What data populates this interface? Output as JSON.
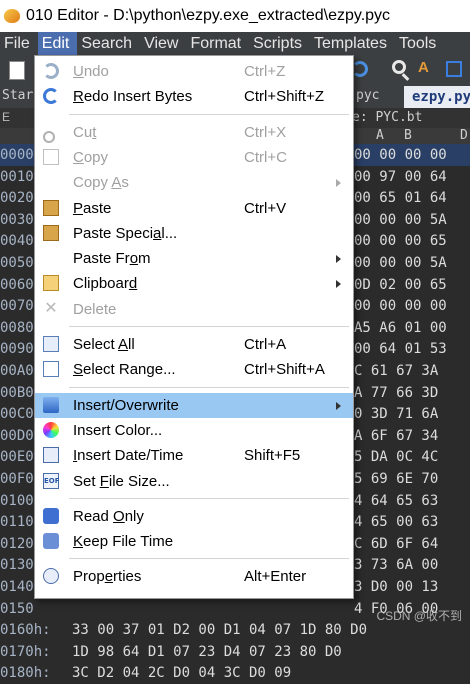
{
  "window": {
    "title": "010 Editor - D:\\python\\ezpy.exe_extracted\\ezpy.pyc"
  },
  "menubar": {
    "items": [
      "File",
      "Edit",
      "Search",
      "View",
      "Format",
      "Scripts",
      "Templates",
      "Tools"
    ],
    "active": "Edit"
  },
  "tabs": {
    "start_label": "Star",
    "pyc_label": "pyc",
    "active_tab": "ezpy.py"
  },
  "template_bar": {
    "label": "e: PYC.bt",
    "left": "E"
  },
  "hex": {
    "header": [
      "A",
      "B",
      "D"
    ],
    "rows": [
      {
        "addr": "0000",
        "cells": "00 00 00 00"
      },
      {
        "addr": "0010",
        "cells": "00 97 00 64"
      },
      {
        "addr": "0020",
        "cells": "00 65 01 64"
      },
      {
        "addr": "0030",
        "cells": "00 00 00 5A"
      },
      {
        "addr": "0040",
        "cells": "00 00 00 65"
      },
      {
        "addr": "0050",
        "cells": "00 00 00 5A"
      },
      {
        "addr": "0060",
        "cells": "0D 02 00 65"
      },
      {
        "addr": "0070",
        "cells": "00 00 00 00"
      },
      {
        "addr": "0080",
        "cells": "A5 A6 01 00"
      },
      {
        "addr": "0090",
        "cells": "00 64 01 53"
      },
      {
        "addr": "00A0",
        "cells": "C 61 67 3A"
      },
      {
        "addr": "00B0",
        "cells": "A 77 66 3D"
      },
      {
        "addr": "00C0",
        "cells": "0 3D 71 6A"
      },
      {
        "addr": "00D0",
        "cells": "A 6F 67 34"
      },
      {
        "addr": "00E0",
        "cells": "5 DA 0C 4C"
      },
      {
        "addr": "00F0",
        "cells": "5 69 6E 70"
      },
      {
        "addr": "0100",
        "cells": "4 64 65 63"
      },
      {
        "addr": "0110",
        "cells": "4 65 00 63"
      },
      {
        "addr": "0120",
        "cells": "C 6D 6F 64"
      },
      {
        "addr": "0130",
        "cells": "3 73 6A 00"
      },
      {
        "addr": "0140",
        "cells": "3 D0 00 13"
      },
      {
        "addr": "0150",
        "cells": "4 F0 06 00"
      },
      {
        "addr": "0160h:",
        "cells": "33 00 37 01 D2 00 D1 04 07 1D 80 D0"
      },
      {
        "addr": "0170h:",
        "cells": "1D 98 64 D1 07 23 D4 07 23 80 D0"
      },
      {
        "addr": "0180h:",
        "cells": "3C D2 04 2C D0 04 3C D0 09"
      }
    ]
  },
  "edit_menu": {
    "items": [
      {
        "label": "Undo",
        "underline": 0,
        "shortcut": "Ctrl+Z",
        "icon": "undo-icon",
        "disabled": true
      },
      {
        "label": "Redo Insert Bytes",
        "underline": 0,
        "shortcut": "Ctrl+Shift+Z",
        "icon": "redo-icon",
        "disabled": false
      },
      {
        "sep": true
      },
      {
        "label": "Cut",
        "underline": 2,
        "shortcut": "Ctrl+X",
        "icon": "cut-icon",
        "disabled": true
      },
      {
        "label": "Copy",
        "underline": 0,
        "shortcut": "Ctrl+C",
        "icon": "copy-icon",
        "disabled": true
      },
      {
        "label": "Copy As",
        "underline": 5,
        "shortcut": "",
        "icon": "",
        "disabled": true,
        "submenu": true
      },
      {
        "label": "Paste",
        "underline": 0,
        "shortcut": "Ctrl+V",
        "icon": "paste-icon",
        "disabled": false
      },
      {
        "label": "Paste Special...",
        "underline": 11,
        "shortcut": "",
        "icon": "paste-special-icon",
        "disabled": false
      },
      {
        "label": "Paste From",
        "underline": 8,
        "shortcut": "",
        "icon": "",
        "disabled": false,
        "submenu": true
      },
      {
        "label": "Clipboard",
        "underline": 8,
        "shortcut": "",
        "icon": "clipboard-icon",
        "disabled": false,
        "submenu": true
      },
      {
        "label": "Delete",
        "underline": -1,
        "shortcut": "",
        "icon": "delete-icon",
        "disabled": true
      },
      {
        "sep": true
      },
      {
        "label": "Select All",
        "underline": 7,
        "shortcut": "Ctrl+A",
        "icon": "select-all-icon",
        "disabled": false
      },
      {
        "label": "Select Range...",
        "underline": 0,
        "shortcut": "Ctrl+Shift+A",
        "icon": "select-range-icon",
        "disabled": false
      },
      {
        "sep": true
      },
      {
        "label": "Insert/Overwrite",
        "underline": -1,
        "shortcut": "",
        "icon": "insert-overwrite-icon",
        "disabled": false,
        "submenu": true,
        "selected": true
      },
      {
        "label": "Insert Color...",
        "underline": -1,
        "shortcut": "",
        "icon": "insert-color-icon",
        "disabled": false
      },
      {
        "label": "Insert Date/Time",
        "underline": 0,
        "shortcut": "Shift+F5",
        "icon": "insert-date-icon",
        "disabled": false
      },
      {
        "label": "Set File Size...",
        "underline": 4,
        "shortcut": "",
        "icon": "set-file-size-icon",
        "disabled": false
      },
      {
        "sep": true
      },
      {
        "label": "Read Only",
        "underline": 5,
        "shortcut": "",
        "icon": "read-only-icon",
        "disabled": false
      },
      {
        "label": "Keep File Time",
        "underline": 0,
        "shortcut": "",
        "icon": "keep-file-time-icon",
        "disabled": false
      },
      {
        "sep": true
      },
      {
        "label": "Properties",
        "underline": 4,
        "shortcut": "Alt+Enter",
        "icon": "properties-icon",
        "disabled": false
      }
    ]
  },
  "watermark": "CSDN @收不到"
}
